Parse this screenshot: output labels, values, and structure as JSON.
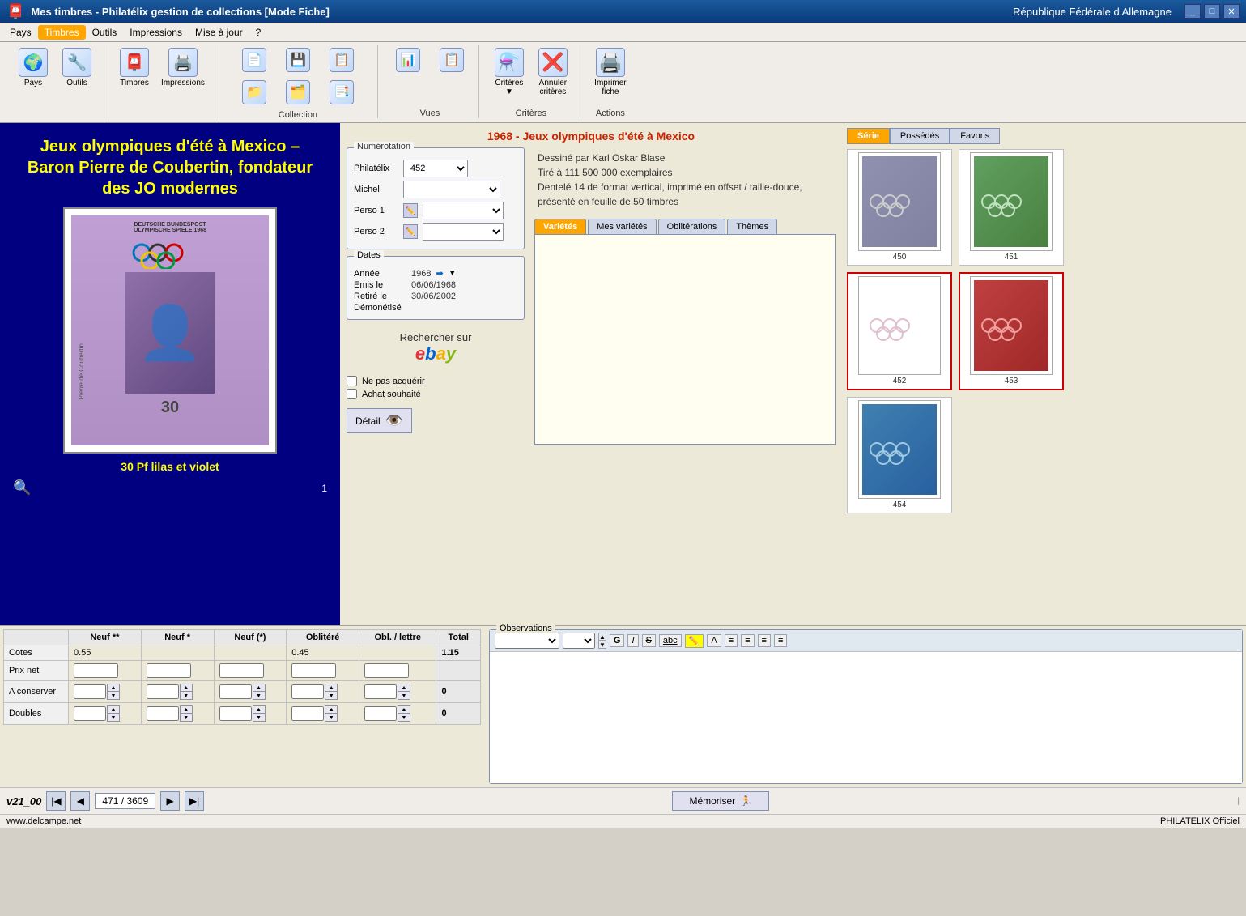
{
  "app": {
    "title": "Mes timbres - Philatélix gestion de collections [Mode Fiche]",
    "right_title": "République Fédérale d Allemagne",
    "version": "v21_00"
  },
  "menu": {
    "items": [
      "Pays",
      "Timbres",
      "Outils",
      "Impressions",
      "Mise à jour",
      "?"
    ],
    "active": "Timbres"
  },
  "toolbar": {
    "sections": [
      {
        "name": "Pays",
        "buttons": [
          {
            "icon": "🌍",
            "label": "Pays"
          },
          {
            "icon": "🔧",
            "label": "Outils"
          }
        ]
      },
      {
        "name": "Timbres",
        "buttons": [
          {
            "icon": "📮",
            "label": "Timbres"
          },
          {
            "icon": "🖨️",
            "label": "Impressions"
          }
        ]
      },
      {
        "name": "Collection",
        "buttons": [
          {
            "icon": "📁",
            "label": ""
          },
          {
            "icon": "💾",
            "label": ""
          },
          {
            "icon": "📄",
            "label": ""
          },
          {
            "icon": "📋",
            "label": ""
          },
          {
            "icon": "🗂️",
            "label": ""
          },
          {
            "icon": "📑",
            "label": ""
          }
        ]
      },
      {
        "name": "Vues",
        "buttons": []
      },
      {
        "name": "Critères",
        "buttons": [
          {
            "icon": "⚗️",
            "label": "Critères"
          },
          {
            "icon": "❌",
            "label": "Annuler critères"
          }
        ]
      },
      {
        "name": "Actions",
        "buttons": [
          {
            "icon": "🖨️",
            "label": "Imprimer fiche"
          }
        ]
      }
    ]
  },
  "stamp": {
    "main_title": "Jeux olympiques d'été à Mexico –\nBaron Pierre de Coubertin, fondateur\ndes JO modernes",
    "subtitle": "30 Pf lilas et violet",
    "page_num": "1",
    "header": "DEUTSCHE BUNDESPOST\nOLYMPISCHE SPIELE 1968",
    "value": "30"
  },
  "series": {
    "title": "1968 - Jeux olympiques d'été à Mexico",
    "description_line1": "Dessiné par Karl Oskar Blase",
    "description_line2": "Tiré à 111 500 000 exemplaires",
    "description_line3": "Dentelé 14 de format vertical, imprimé en offset / taille-douce,",
    "description_line4": "présenté en feuille de 50 timbres"
  },
  "numerotation": {
    "label": "Numérotation",
    "philatelix_label": "Philatélix",
    "philatelix_value": "452",
    "michel_label": "Michel",
    "perso1_label": "Perso 1",
    "perso2_label": "Perso 2"
  },
  "dates": {
    "label": "Dates",
    "annee_label": "Année",
    "annee_value": "1968",
    "emis_le_label": "Emis le",
    "emis_le_value": "06/06/1968",
    "retire_le_label": "Retiré le",
    "retire_le_value": "30/06/2002",
    "demonetise_label": "Démonétisé"
  },
  "ebay": {
    "rechercher_sur": "Rechercher sur",
    "logo": "ebay"
  },
  "checkboxes": {
    "ne_pas_acquerir": "Ne pas acquérir",
    "achat_souhaite": "Achat souhaité"
  },
  "detail_btn": "Détail",
  "tabs": {
    "items": [
      "Variétés",
      "Mes variétés",
      "Oblitérations",
      "Thèmes"
    ],
    "active": "Variétés"
  },
  "series_tabs": {
    "items": [
      "Série",
      "Possédés",
      "Favoris"
    ],
    "active": "Série"
  },
  "stamps_series": [
    {
      "num": "450",
      "bg": "#8080a0",
      "color": "#d0c0e0"
    },
    {
      "num": "451",
      "bg": "#508050",
      "color": "#c0e0c0"
    },
    {
      "num": "452",
      "bg": "#a07080",
      "color": "#e0c0c8"
    },
    {
      "num": "453",
      "bg": "#c04040",
      "color": "#f0a0a0"
    },
    {
      "num": "454",
      "bg": "#4080a0",
      "color": "#a0c8e0"
    }
  ],
  "price_table": {
    "headers": [
      "Neuf **",
      "Neuf *",
      "Neuf (*)",
      "Oblitéré",
      "Obl. / lettre",
      "Total"
    ],
    "rows": [
      {
        "label": "Cotes",
        "neuf2": "0.55",
        "neuf1": "",
        "neufp": "",
        "oblitere": "0.45",
        "obl_lettre": "",
        "total": "1.15"
      },
      {
        "label": "Prix net",
        "neuf2": "",
        "neuf1": "",
        "neufp": "",
        "oblitere": "",
        "obl_lettre": "",
        "total": ""
      },
      {
        "label": "A conserver",
        "neuf2": "",
        "neuf1": "",
        "neufp": "",
        "oblitere": "",
        "obl_lettre": "",
        "total": "0"
      },
      {
        "label": "Doubles",
        "neuf2": "",
        "neuf1": "",
        "neufp": "",
        "oblitere": "",
        "obl_lettre": "",
        "total": "0"
      }
    ]
  },
  "navigation": {
    "position": "471",
    "total": "3609",
    "memorize_btn": "Mémoriser"
  },
  "observations": {
    "label": "Observations"
  },
  "status_bar": {
    "left": "www.delcampe.net",
    "right": "PHILATELIX Officiel"
  }
}
